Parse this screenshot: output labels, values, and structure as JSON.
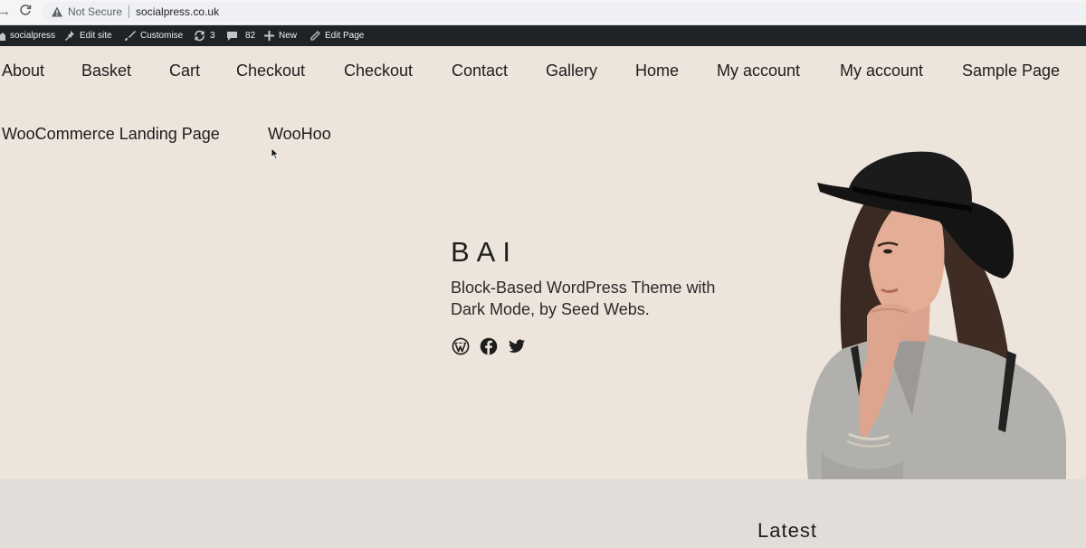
{
  "browser": {
    "security_label": "Not Secure",
    "url": "socialpress.co.uk"
  },
  "admin_bar": {
    "site_name": "socialpress",
    "edit_site": "Edit site",
    "customise": "Customise",
    "updates_count": "3",
    "comments_count": "82",
    "new": "New",
    "edit_page": "Edit Page"
  },
  "nav": {
    "items": [
      "About",
      "Basket",
      "Cart",
      "Checkout",
      "Checkout",
      "Contact",
      "Gallery",
      "Home",
      "My account",
      "My account",
      "Sample Page",
      "WooCommerce Landing Page",
      "WooHoo"
    ]
  },
  "hero": {
    "title": "BAI",
    "tagline": "Block-Based WordPress Theme with Dark Mode, by Seed Webs.",
    "social_icons": [
      "wordpress-icon",
      "facebook-icon",
      "twitter-icon"
    ]
  },
  "latest": {
    "heading": "Latest"
  },
  "colors": {
    "page_background": "#ede4dc",
    "admin_bar": "#1d2327",
    "lower_section": "#e2ddd9",
    "text": "#1d1d1d"
  }
}
